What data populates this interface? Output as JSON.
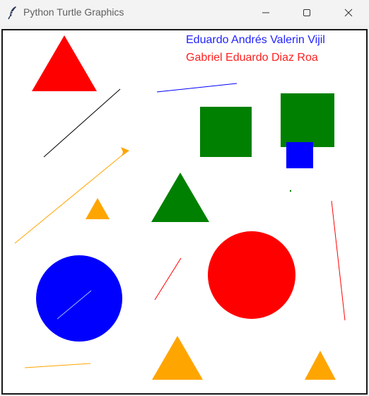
{
  "window": {
    "title": "Python Turtle Graphics",
    "app_icon": "feather-icon",
    "controls": {
      "minimize_icon": "minimize-icon",
      "maximize_icon": "maximize-icon",
      "close_icon": "close-icon"
    }
  },
  "canvas": {
    "background": "#ffffff",
    "labels": [
      {
        "text": "Eduardo Andrés Valerin Vijil",
        "color": "#2222ff"
      },
      {
        "text": "Gabriel Eduardo Diaz Roa",
        "color": "#ff2020"
      }
    ],
    "colors": {
      "red": "#ff0000",
      "green": "#008000",
      "blue": "#0000ff",
      "orange": "#ffa500",
      "black": "#000000",
      "white": "#ffffff"
    }
  }
}
